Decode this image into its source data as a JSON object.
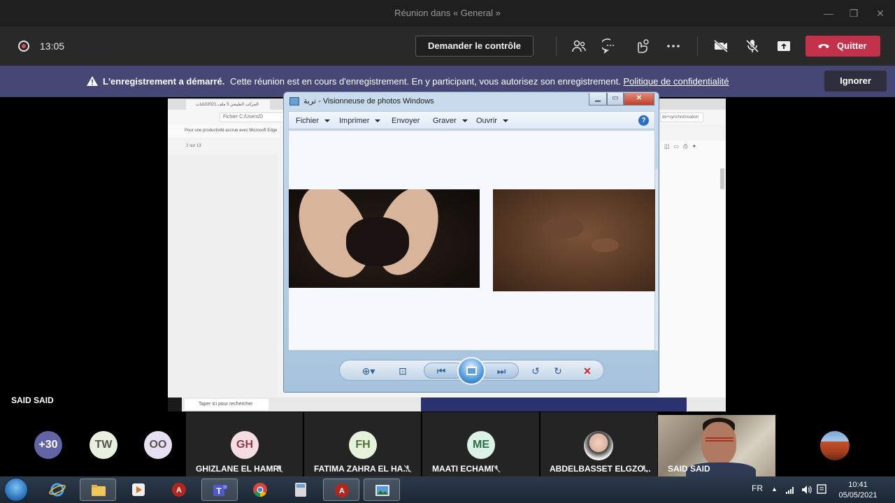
{
  "window": {
    "title": "Réunion dans « General »"
  },
  "toolbar": {
    "timer": "13:05",
    "control_label": "Demander le contrôle",
    "quit_label": "Quitter",
    "icons": [
      "participants-icon",
      "chat-icon",
      "reactions-icon",
      "more-options-icon",
      "camera-off-icon",
      "mic-off-icon",
      "share-screen-icon"
    ]
  },
  "banner": {
    "bold": "L'enregistrement a démarré.",
    "text": "Cette réunion est en cours d'enregistrement. En y participant, vous autorisez son enregistrement.",
    "link": "Politique de confidentialité",
    "ignore_label": "Ignorer"
  },
  "shared_screen": {
    "presenter_name": "SAID SAID",
    "tab_title": "المركب الطبيعي 5 ملف.2021الكتاب",
    "url_prefix": "Fichier",
    "url": "C:/Users/D",
    "info_text": "Pour une productivité accrue avec Microsoft Edge",
    "page_current": "2",
    "page_total": "sur 13",
    "right_url": "de+synchronisation",
    "taskbar_search": "Taper ici pour rechercher",
    "taskbar_item": "Fichiers"
  },
  "viewer": {
    "title": "تربة - Visionneuse de photos Windows",
    "menu": [
      {
        "label": "Fichier",
        "dropdown": true
      },
      {
        "label": "Imprimer",
        "dropdown": true
      },
      {
        "label": "Envoyer",
        "dropdown": false
      },
      {
        "label": "Graver",
        "dropdown": true
      },
      {
        "label": "Ouvrir",
        "dropdown": true
      }
    ],
    "help": "?"
  },
  "participants": [
    {
      "initials": "+30",
      "bg": "#6264a7",
      "fg": "#ffffff"
    },
    {
      "initials": "TW",
      "bg": "#e8f0e0",
      "fg": "#555555"
    },
    {
      "initials": "OO",
      "bg": "#e6e0f2",
      "fg": "#555555"
    },
    {
      "initials": "GH",
      "bg": "#f6dde3",
      "fg": "#8a3a4a",
      "name": "GHIZLANE EL HAMRI"
    },
    {
      "initials": "FH",
      "bg": "#e7f2dc",
      "fg": "#55703a",
      "name": "FATIMA ZAHRA EL HA..."
    },
    {
      "initials": "ME",
      "bg": "#dcf2e6",
      "fg": "#2f6b4a",
      "name": "MAATI ECHAMI"
    },
    {
      "name": "ABDELBASSET ELGZO..."
    },
    {
      "name": "SAID SAID"
    }
  ],
  "taskbar": {
    "language": "FR",
    "time": "10:41",
    "date": "05/05/2021"
  },
  "colors": {
    "teams_purple": "#464775",
    "quit_red": "#c4314b",
    "toolbar_bg": "#292929"
  }
}
